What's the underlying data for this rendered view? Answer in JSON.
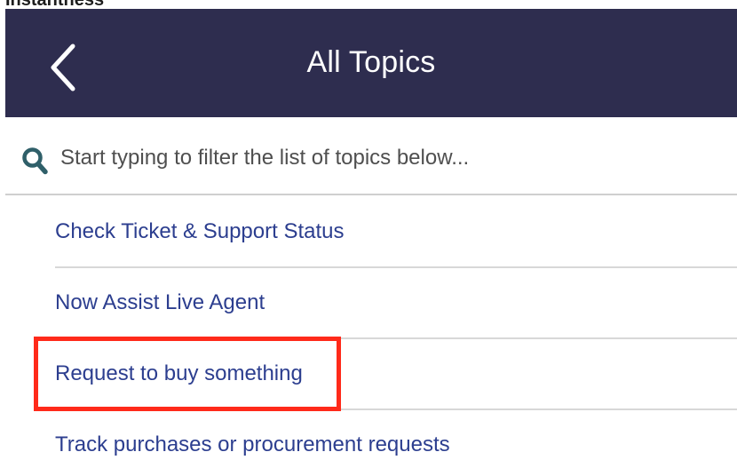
{
  "cut_label": "Instantness",
  "header": {
    "back_icon": "chevron-left-icon",
    "title": "All Topics",
    "background_color": "#2e2d4f"
  },
  "search": {
    "icon": "search-icon",
    "placeholder": "Start typing to filter the list of topics below...",
    "value": "",
    "icon_color": "#2f5f69"
  },
  "topics": [
    {
      "label": "Check Ticket & Support Status"
    },
    {
      "label": "Now Assist Live Agent"
    },
    {
      "label": "Request to buy something"
    },
    {
      "label": "Track purchases or procurement requests"
    }
  ],
  "highlight": {
    "target": "Request to buy something",
    "color": "#ff2a1a"
  },
  "colors": {
    "link": "#2c3e8f",
    "divider": "#d8d8d8"
  }
}
